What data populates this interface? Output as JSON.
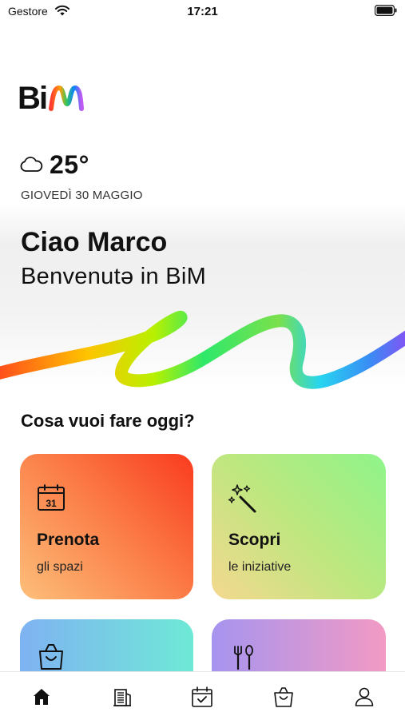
{
  "status_bar": {
    "carrier": "Gestore",
    "time": "17:21"
  },
  "brand": {
    "logo_text": "BiM"
  },
  "weather": {
    "icon": "cloud-icon",
    "temperature": "25°",
    "date": "GIOVEDÌ 30 MAGGIO"
  },
  "hero": {
    "greeting": "Ciao Marco",
    "welcome": "Benvenutə in BiM"
  },
  "question": "Cosa vuoi fare oggi?",
  "cards": [
    {
      "title": "Prenota",
      "subtitle": "gli spazi",
      "icon": "calendar-icon"
    },
    {
      "title": "Scopri",
      "subtitle": "le iniziative",
      "icon": "magic-wand-icon"
    },
    {
      "title": "",
      "subtitle": "",
      "icon": "shopping-bag-icon"
    },
    {
      "title": "",
      "subtitle": "",
      "icon": "cutlery-icon"
    }
  ],
  "tab_bar": [
    {
      "icon": "home-icon",
      "active": true
    },
    {
      "icon": "building-icon",
      "active": false
    },
    {
      "icon": "calendar-check-icon",
      "active": false
    },
    {
      "icon": "shopping-bag-icon",
      "active": false
    },
    {
      "icon": "profile-icon",
      "active": false
    }
  ],
  "colors": {
    "text": "#111111",
    "background": "#ffffff"
  }
}
